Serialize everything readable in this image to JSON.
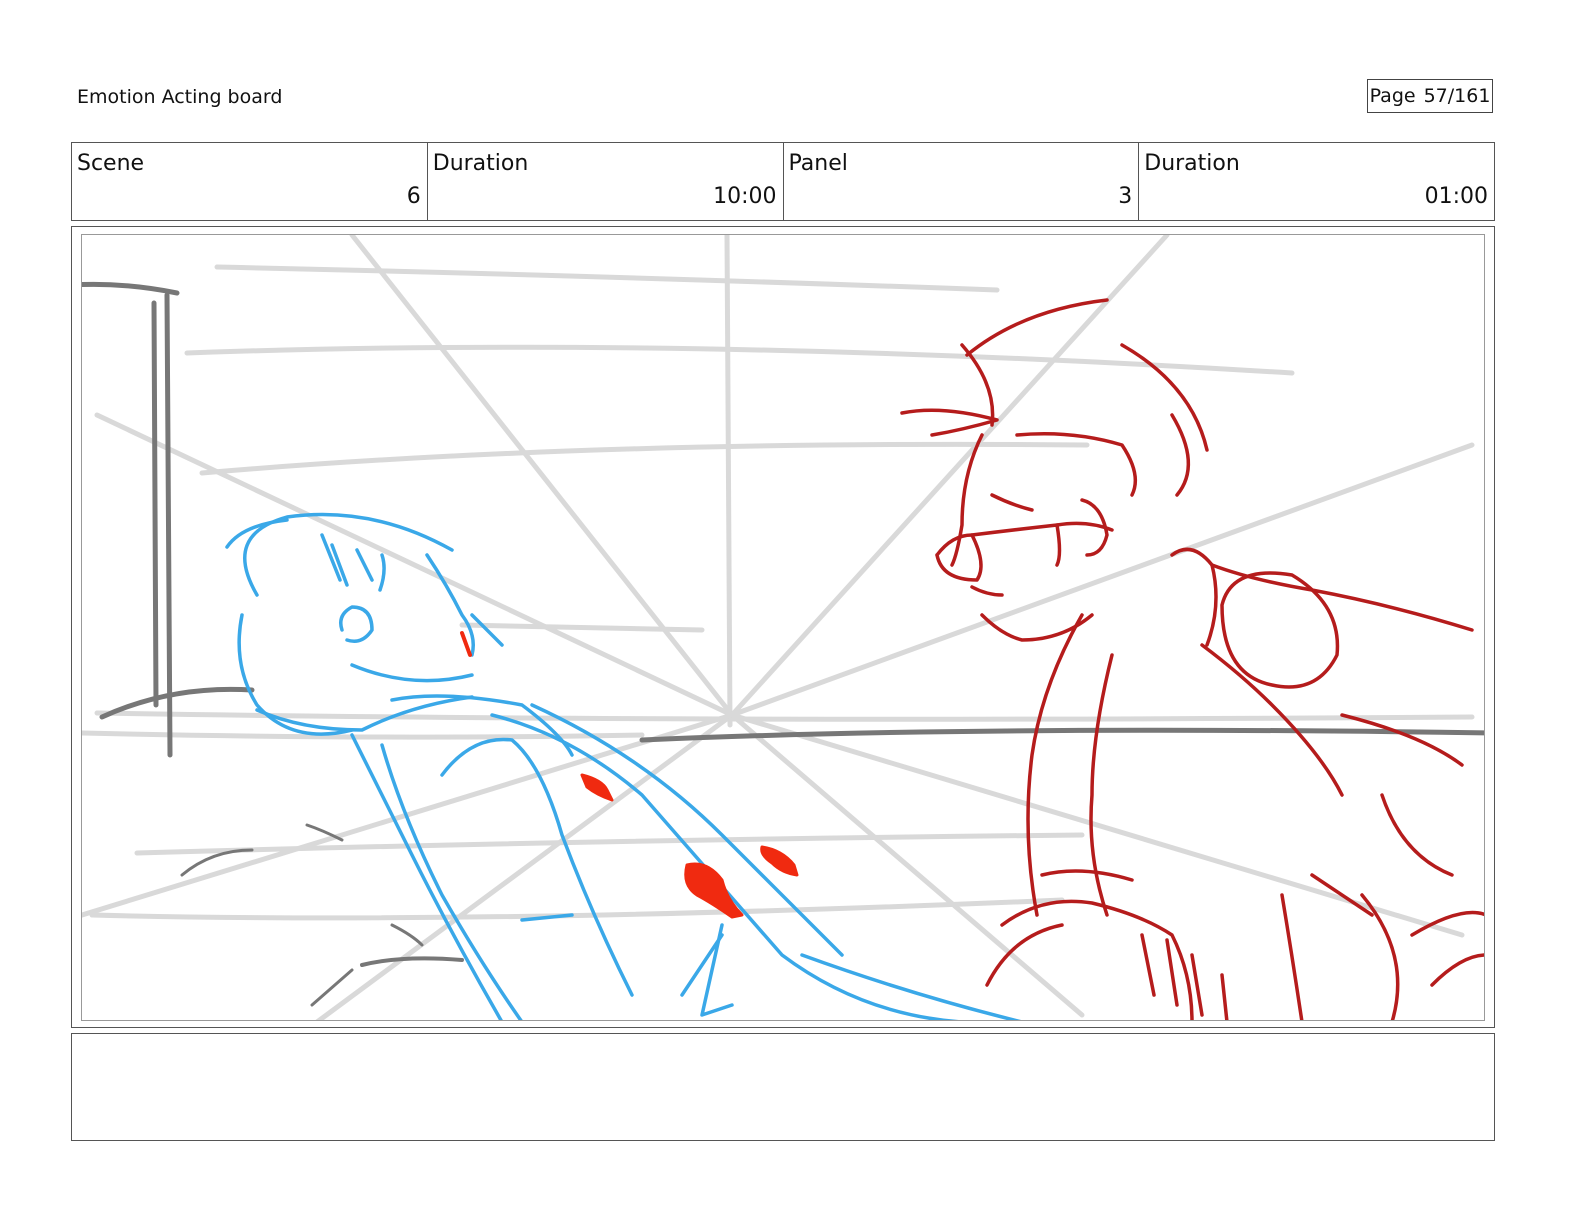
{
  "header": {
    "board_title": "Emotion Acting board",
    "page_label": "Page",
    "page_number": "57/161"
  },
  "info": {
    "scene_label": "Scene",
    "scene_value": "6",
    "scene_duration_label": "Duration",
    "scene_duration_value": "10:00",
    "panel_label": "Panel",
    "panel_value": "3",
    "panel_duration_label": "Duration",
    "panel_duration_value": "01:00"
  },
  "notes": {
    "text": ""
  },
  "colors": {
    "background_lines": "#d9d9d9",
    "wall_lines": "#777777",
    "left_character": "#3aa8e8",
    "right_character": "#b51c1c",
    "blood": "#f02a10"
  }
}
